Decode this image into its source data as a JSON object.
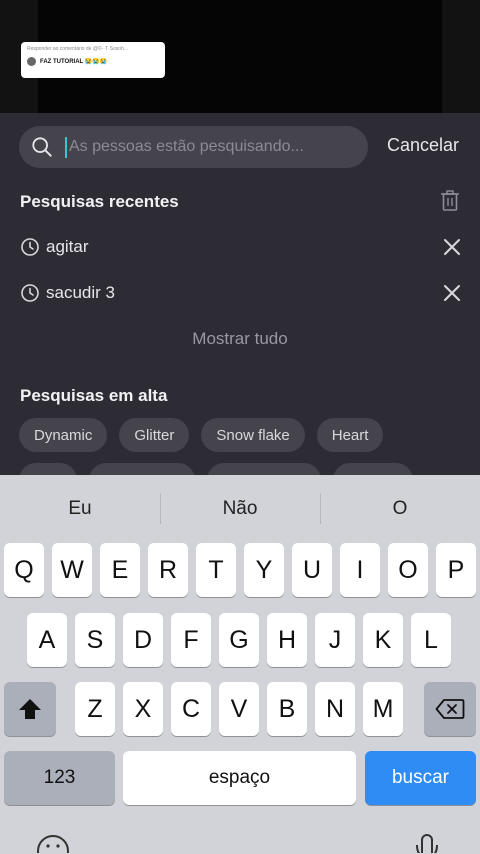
{
  "video": {
    "reply_card": {
      "line1": "Responder ao comentário de @©··T·Sosoh...",
      "line2": "FAZ TUTORIAL 😭😭😭"
    }
  },
  "search": {
    "placeholder": "As pessoas estão pesquisando...",
    "cancel_label": "Cancelar"
  },
  "recent": {
    "title": "Pesquisas recentes",
    "items": [
      {
        "label": "agitar"
      },
      {
        "label": "sacudir 3"
      }
    ],
    "show_all": "Mostrar tudo"
  },
  "trending": {
    "title": "Pesquisas em alta",
    "chips": [
      "Dynamic",
      "Glitter",
      "Snow flake",
      "Heart"
    ]
  },
  "keyboard": {
    "suggestions": [
      "Eu",
      "Não",
      "O"
    ],
    "row1": [
      "Q",
      "W",
      "E",
      "R",
      "T",
      "Y",
      "U",
      "I",
      "O",
      "P"
    ],
    "row2": [
      "A",
      "S",
      "D",
      "F",
      "G",
      "H",
      "J",
      "K",
      "L"
    ],
    "row3": [
      "Z",
      "X",
      "C",
      "V",
      "B",
      "N",
      "M"
    ],
    "numbers_label": "123",
    "space_label": "espaço",
    "search_label": "buscar"
  },
  "colors": {
    "panel_bg": "#2d2c35",
    "accent_caret": "#36c6d6",
    "search_key": "#2f8cf4"
  }
}
